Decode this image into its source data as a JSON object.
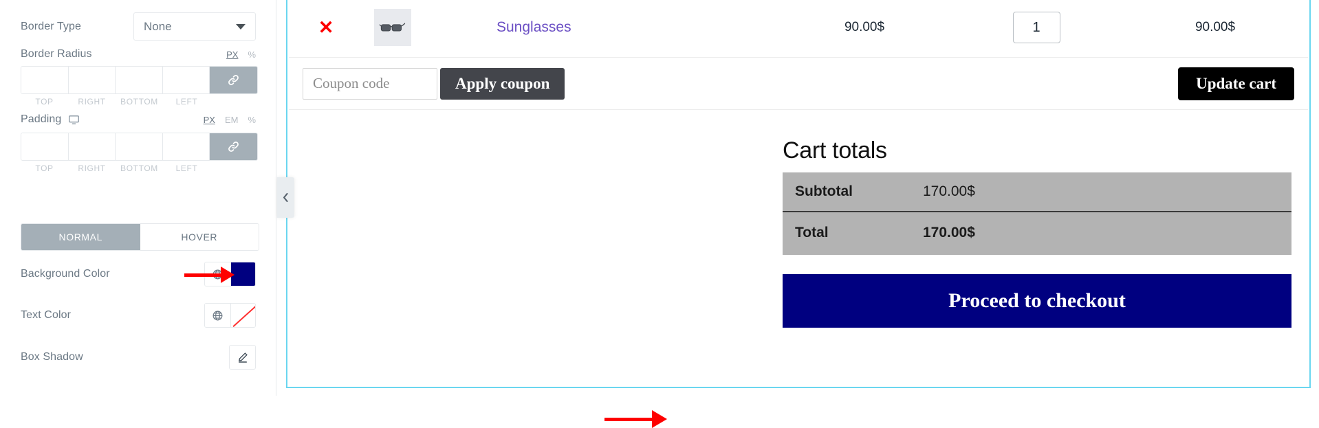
{
  "panel": {
    "border_type": {
      "label": "Border Type",
      "value": "None"
    },
    "border_radius": {
      "label": "Border Radius",
      "units": [
        "PX",
        "%"
      ],
      "active_unit": "PX",
      "sides": [
        "TOP",
        "RIGHT",
        "BOTTOM",
        "LEFT"
      ],
      "values": [
        "",
        "",
        "",
        ""
      ]
    },
    "padding": {
      "label": "Padding",
      "units": [
        "PX",
        "EM",
        "%"
      ],
      "active_unit": "PX",
      "sides": [
        "TOP",
        "RIGHT",
        "BOTTOM",
        "LEFT"
      ],
      "values": [
        "",
        "",
        "",
        ""
      ]
    },
    "state_tabs": {
      "normal": "NORMAL",
      "hover": "HOVER",
      "active": "NORMAL"
    },
    "background_color": {
      "label": "Background Color",
      "value": "#000080"
    },
    "text_color": {
      "label": "Text Color",
      "value": ""
    },
    "box_shadow": {
      "label": "Box Shadow"
    }
  },
  "preview": {
    "cart_item": {
      "remove_icon": "✕",
      "product_name": "Sunglasses",
      "price": "90.00$",
      "quantity": "1",
      "subtotal": "90.00$"
    },
    "coupon": {
      "placeholder": "Coupon code",
      "value": "",
      "apply_label": "Apply coupon",
      "update_label": "Update cart"
    },
    "totals": {
      "title": "Cart totals",
      "rows": [
        {
          "label": "Subtotal",
          "amount": "170.00$"
        },
        {
          "label": "Total",
          "amount": "170.00$"
        }
      ]
    },
    "checkout_label": "Proceed to checkout"
  }
}
